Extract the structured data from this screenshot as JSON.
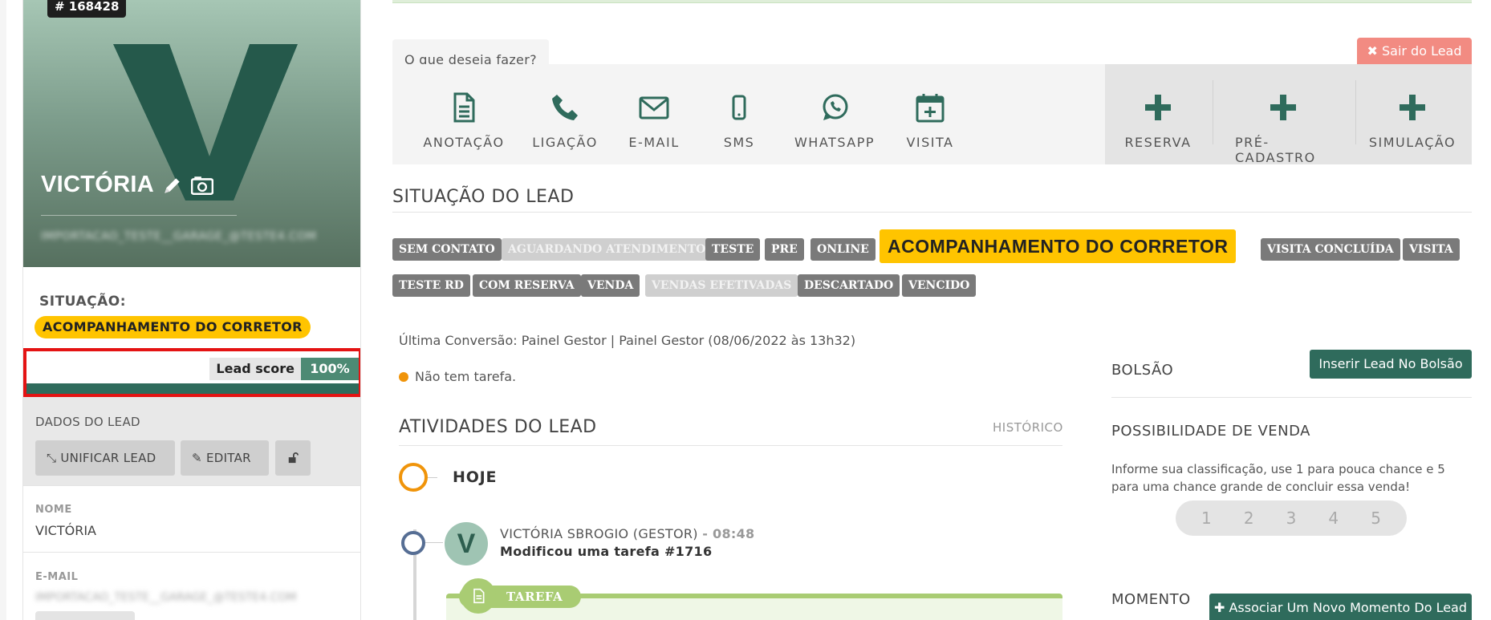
{
  "lead": {
    "id": "# 168428",
    "name": "VICTÓRIA",
    "email_hidden": "IMPORTACAO_TESTE__GARAGE_@TESTE4.COM",
    "situacao_label": "SITUAÇÃO:",
    "situacao": "ACOMPANHAMENTO DO CORRETOR",
    "score_label": "Lead score",
    "score_value": "100%",
    "score_fraction": 1.0
  },
  "dados": {
    "title": "DADOS DO LEAD",
    "unificar": "UNIFICAR LEAD",
    "editar": "EDITAR",
    "nome_label": "NOME",
    "nome": "VICTÓRIA",
    "email_label": "E-MAIL",
    "email_hidden": "IMPORTACAO_TESTE__GARAGE_@TESTE4.COM"
  },
  "acoes": {
    "prompt": "O que deseja fazer?",
    "sair": "✖ Sair do Lead",
    "items": [
      "ANOTAÇÃO",
      "LIGAÇÃO",
      "E-MAIL",
      "SMS",
      "WHATSAPP",
      "VISITA"
    ],
    "extra": [
      "RESERVA",
      "PRÉ-CADASTRO",
      "SIMULAÇÃO"
    ]
  },
  "situacao": {
    "title": "SITUAÇÃO DO LEAD",
    "row1": [
      "SEM CONTATO",
      "AGUARDANDO ATENDIMENTO",
      "TESTE",
      "PRE",
      "ONLINE",
      "ACOMPANHAMENTO DO CORRETOR",
      "VISITA CONCLUÍDA",
      "VISITA"
    ],
    "row2": [
      "TESTE RD",
      "COM RESERVA",
      "VENDA",
      "VENDAS EFETIVADAS",
      "DESCARTADO",
      "VENCIDO"
    ]
  },
  "conversao": "Última Conversão: Painel Gestor | Painel Gestor (08/06/2022 às 13h32)",
  "no_task": "Não tem tarefa.",
  "atividades": {
    "title": "ATIVIDADES DO LEAD",
    "historico": "HISTÓRICO",
    "hoje": "HOJE",
    "avatar_letter": "V",
    "author": "VICTÓRIA SBROGIO (GESTOR)",
    "time": "- 08:48",
    "desc": "Modificou uma tarefa #1716",
    "tarefa": "TAREFA"
  },
  "right": {
    "bolsao": "BOLSÃO",
    "bolsao_btn": "Inserir Lead No Bolsão",
    "possibilidade": "POSSIBILIDADE DE VENDA",
    "possibilidade_text": "Informe sua classificação, use 1 para pouca chance e 5 para uma chance grande de concluir essa venda!",
    "ratings": [
      "1",
      "2",
      "3",
      "4",
      "5"
    ],
    "momento": "MOMENTO",
    "momento_btn": "✚ Associar Um Novo Momento Do Lead"
  },
  "colors": {
    "accent": "#2f6b5c",
    "status_yellow": "#ffc400",
    "highlight_red": "#e41313"
  }
}
